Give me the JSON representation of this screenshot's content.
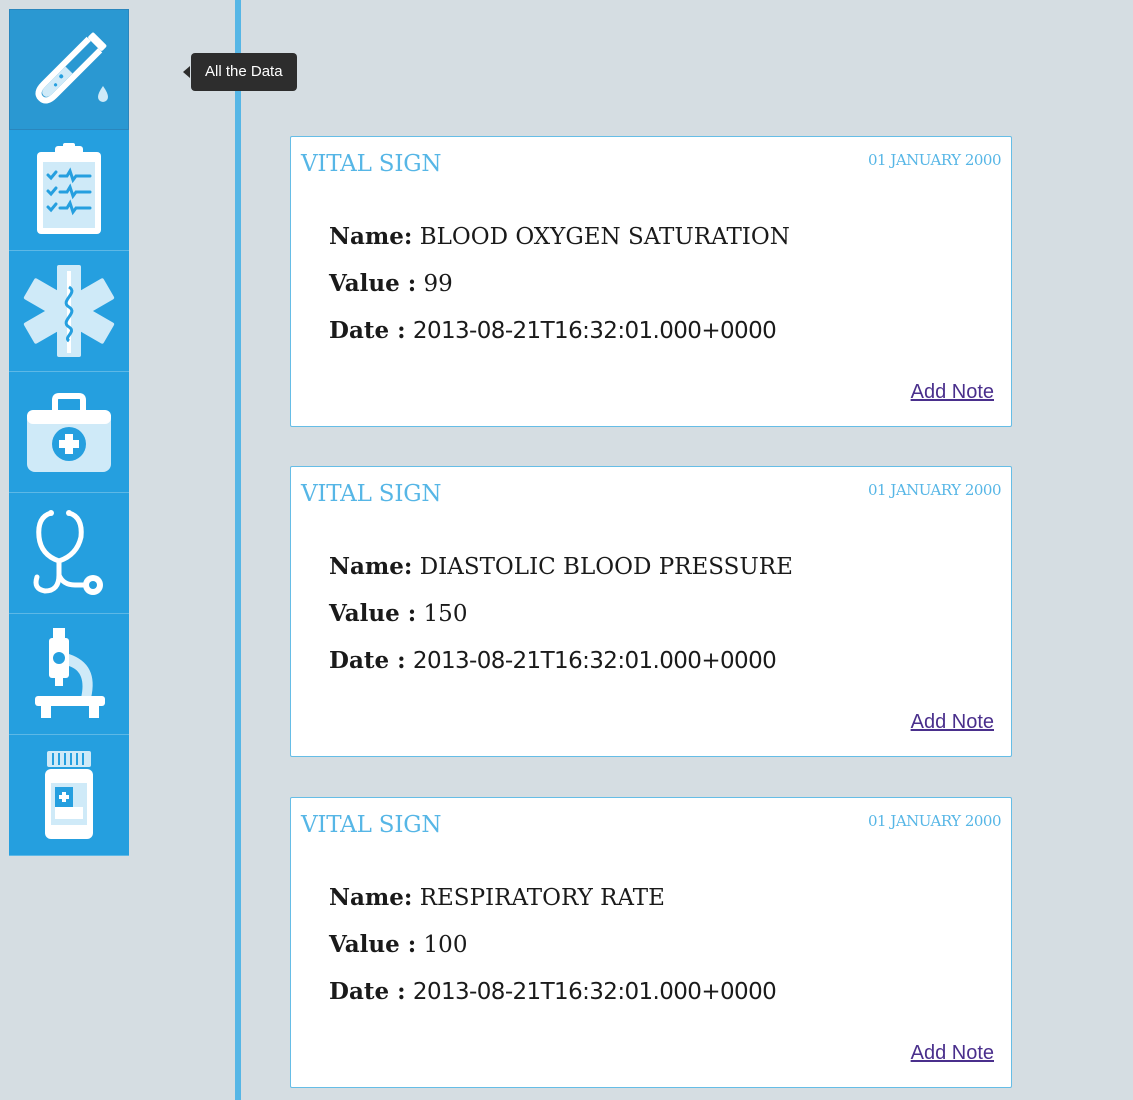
{
  "tooltip": {
    "text": "All the Data"
  },
  "sidebar": {
    "items": [
      {
        "name": "all-the-data",
        "icon": "test-tube-icon",
        "active": true
      },
      {
        "name": "clipboard",
        "icon": "clipboard-checklist-icon"
      },
      {
        "name": "medical-star",
        "icon": "star-of-life-icon"
      },
      {
        "name": "medical-kit",
        "icon": "first-aid-kit-icon"
      },
      {
        "name": "stethoscope",
        "icon": "stethoscope-icon"
      },
      {
        "name": "microscope",
        "icon": "microscope-icon"
      },
      {
        "name": "medication",
        "icon": "pill-bottle-icon"
      }
    ]
  },
  "cards": [
    {
      "type": "VITAL SIGN",
      "date": "01 JANUARY 2000",
      "name_label": "Name:",
      "name_value": "BLOOD OXYGEN SATURATION",
      "value_label": "Value :",
      "value_value": "99",
      "date_label": "Date :",
      "date_value": "2013-08-21T16:32:01.000+0000",
      "add_note": "Add Note"
    },
    {
      "type": "VITAL SIGN",
      "date": "01 JANUARY 2000",
      "name_label": "Name:",
      "name_value": "DIASTOLIC BLOOD PRESSURE",
      "value_label": "Value :",
      "value_value": "150",
      "date_label": "Date :",
      "date_value": "2013-08-21T16:32:01.000+0000",
      "add_note": "Add Note"
    },
    {
      "type": "VITAL SIGN",
      "date": "01 JANUARY 2000",
      "name_label": "Name:",
      "name_value": "RESPIRATORY RATE",
      "value_label": "Value :",
      "value_value": "100",
      "date_label": "Date :",
      "date_value": "2013-08-21T16:32:01.000+0000",
      "add_note": "Add Note"
    }
  ],
  "colors": {
    "background": "#d5dde2",
    "sidebar": "#259fdf",
    "accent": "#56b6e6",
    "link": "#4a2f8c"
  }
}
